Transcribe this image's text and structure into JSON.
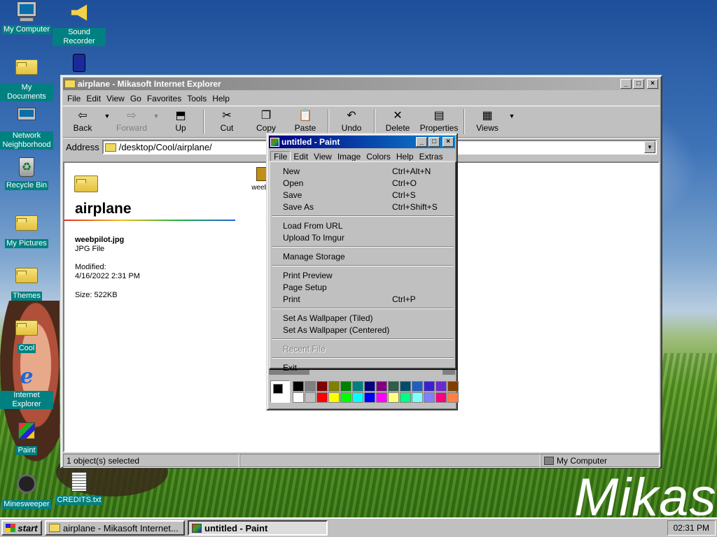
{
  "brand_text": "Mikas",
  "desktop_icons": [
    {
      "label": "My Computer",
      "icon": "my-computer-icon"
    },
    {
      "label": "Sound Recorder",
      "icon": "sound-recorder-icon"
    },
    {
      "label": "My Documents",
      "icon": "my-documents-icon"
    },
    {
      "label": "Network Neighborhood",
      "icon": "network-icon"
    },
    {
      "label": "Recycle Bin",
      "icon": "recycle-bin-icon"
    },
    {
      "label": "My Pictures",
      "icon": "folder-icon"
    },
    {
      "label": "Themes",
      "icon": "folder-icon"
    },
    {
      "label": "Cool",
      "icon": "folder-icon"
    },
    {
      "label": "Internet Explorer",
      "icon": "ie-icon"
    },
    {
      "label": "Paint",
      "icon": "paint-icon"
    },
    {
      "label": "Minesweeper",
      "icon": "minesweeper-icon"
    },
    {
      "label": "CREDITS.txt",
      "icon": "text-file-icon"
    }
  ],
  "explorer": {
    "title": "airplane - Mikasoft Internet Explorer",
    "menu": [
      "File",
      "Edit",
      "View",
      "Go",
      "Favorites",
      "Tools",
      "Help"
    ],
    "toolbar": {
      "back": "Back",
      "forward": "Forward",
      "up": "Up",
      "cut": "Cut",
      "copy": "Copy",
      "paste": "Paste",
      "undo": "Undo",
      "delete": "Delete",
      "properties": "Properties",
      "views": "Views"
    },
    "address_label": "Address",
    "address_value": "/desktop/Cool/airplane/",
    "folder_title": "airplane",
    "selected_file": {
      "name": "weebpilot.jpg",
      "type": "JPG File",
      "modified_label": "Modified:",
      "modified_value": "4/16/2022 2:31 PM",
      "size": "Size: 522KB"
    },
    "file_icon_label": "weebp",
    "status_left": "1 object(s) selected",
    "status_right": "My Computer"
  },
  "paint": {
    "title": "untitled - Paint",
    "menu": [
      "File",
      "Edit",
      "View",
      "Image",
      "Colors",
      "Help",
      "Extras"
    ],
    "file_menu": {
      "new": {
        "label": "New",
        "shortcut": "Ctrl+Alt+N"
      },
      "open": {
        "label": "Open",
        "shortcut": "Ctrl+O"
      },
      "save": {
        "label": "Save",
        "shortcut": "Ctrl+S"
      },
      "save_as": {
        "label": "Save As",
        "shortcut": "Ctrl+Shift+S"
      },
      "load_url": {
        "label": "Load From URL"
      },
      "upload": {
        "label": "Upload To Imgur"
      },
      "manage": {
        "label": "Manage Storage"
      },
      "print_preview": {
        "label": "Print Preview"
      },
      "page_setup": {
        "label": "Page Setup"
      },
      "print": {
        "label": "Print",
        "shortcut": "Ctrl+P"
      },
      "wp_tiled": {
        "label": "Set As Wallpaper (Tiled)"
      },
      "wp_centered": {
        "label": "Set As Wallpaper (Centered)"
      },
      "recent": {
        "label": "Recent File"
      },
      "exit": {
        "label": "Exit"
      }
    },
    "palette": [
      "#000000",
      "#808080",
      "#800000",
      "#808000",
      "#008000",
      "#008080",
      "#000080",
      "#800080",
      "#2e5d4a",
      "#004c6b",
      "#1f5fbf",
      "#3b1fd4",
      "#6b2ad0",
      "#804000",
      "#ffffff",
      "#c0c0c0",
      "#ff0000",
      "#ffff00",
      "#00ff00",
      "#00ffff",
      "#0000ff",
      "#ff00ff",
      "#ffff80",
      "#00ff80",
      "#80ffff",
      "#8080ff",
      "#ff0080",
      "#ff8040"
    ]
  },
  "taskbar": {
    "start": "start",
    "tasks": [
      "airplane - Mikasoft Internet...",
      "untitled - Paint"
    ],
    "clock": "02:31 PM"
  }
}
